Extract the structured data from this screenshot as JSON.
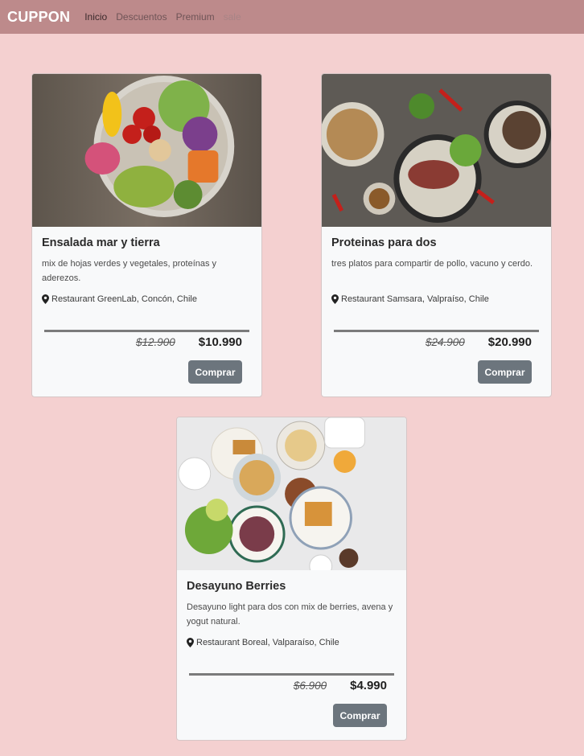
{
  "navbar": {
    "brand": "CUPPON",
    "links": [
      {
        "label": "Inicio"
      },
      {
        "label": "Descuentos"
      },
      {
        "label": "Premium"
      },
      {
        "label": "sale"
      }
    ]
  },
  "cards": [
    {
      "title": "Ensalada mar y tierra",
      "description": "mix de hojas verdes y vegetales, proteínas y aderezos.",
      "location": "Restaurant GreenLab, Concón, Chile",
      "old_price": "$12.900",
      "new_price": "$10.990",
      "button": "Comprar"
    },
    {
      "title": "Proteinas para dos",
      "description": "tres platos para compartir de pollo, vacuno y cerdo.",
      "location": "Restaurant Samsara, Valpraíso, Chile",
      "old_price": "$24.900",
      "new_price": "$20.990",
      "button": "Comprar"
    },
    {
      "title": "Desayuno Berries",
      "description": "Desayuno light para dos con mix de berries, avena y yogut natural.",
      "location": "Restaurant Boreal, Valparaíso, Chile",
      "old_price": "$6.900",
      "new_price": "$4.990",
      "button": "Comprar"
    }
  ],
  "colors": {
    "page_background": "#f4d0d0",
    "navbar_background": "#bd8a8b",
    "button_background": "#6c757d"
  },
  "icons": [
    "map-marker-icon"
  ]
}
